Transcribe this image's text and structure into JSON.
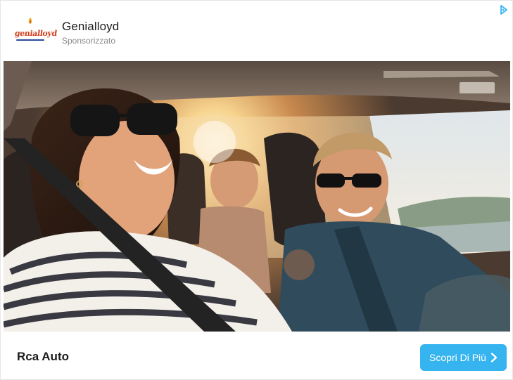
{
  "advertiser": {
    "logo_text": "genialloyd",
    "name": "Genialloyd",
    "sponsored_label": "Sponsorizzato"
  },
  "ad": {
    "headline": "Rca Auto",
    "cta_label": "Scopri Di Più",
    "adchoices_icon": "adchoices-icon",
    "cta_icon": "chevron-right-icon"
  },
  "colors": {
    "cta_background": "#36b4ef",
    "logo_red": "#d0401d",
    "logo_blue": "#2a4c9a"
  }
}
